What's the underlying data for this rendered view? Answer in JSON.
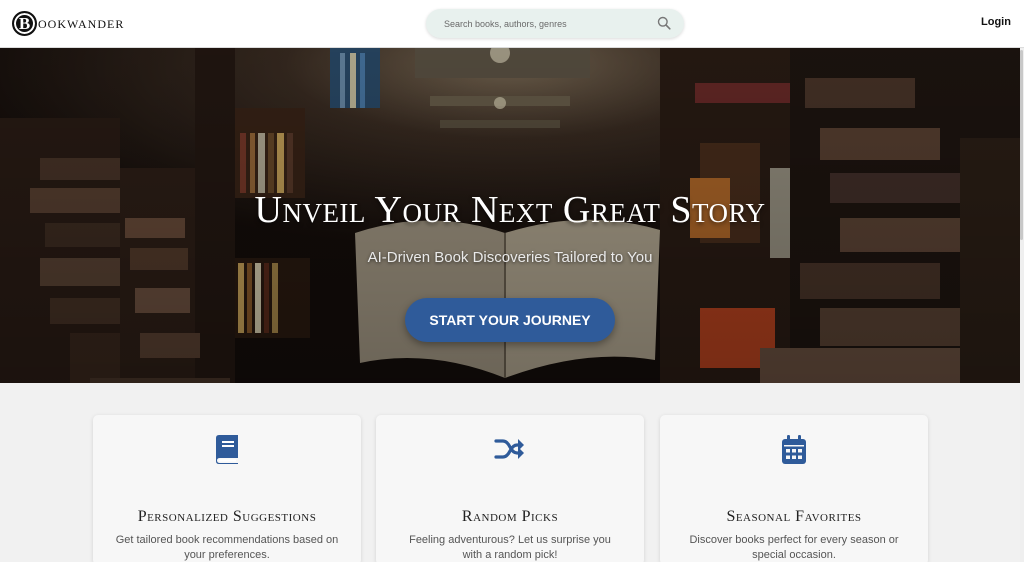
{
  "header": {
    "logo_letter": "B",
    "logo_text": "OOKWANDER",
    "search_placeholder": "Search books, authors, genres",
    "login_label": "Login"
  },
  "hero": {
    "title": "Unveil Your Next Great Story",
    "subtitle": "AI-Driven Book Discoveries Tailored to You",
    "cta_label": "START YOUR JOURNEY"
  },
  "features": [
    {
      "icon": "book-icon",
      "title": "Personalized Suggestions",
      "description": "Get tailored book recommendations based on your preferences."
    },
    {
      "icon": "shuffle-icon",
      "title": "Random Picks",
      "description": "Feeling adventurous? Let us surprise you with a random pick!"
    },
    {
      "icon": "calendar-icon",
      "title": "Seasonal Favorites",
      "description": "Discover books perfect for every season or special occasion."
    }
  ],
  "colors": {
    "accent": "#2f5b9a",
    "icon": "#2f5b9a",
    "search_bg": "#e8f1ee",
    "hero_bg": "#1d1410"
  }
}
